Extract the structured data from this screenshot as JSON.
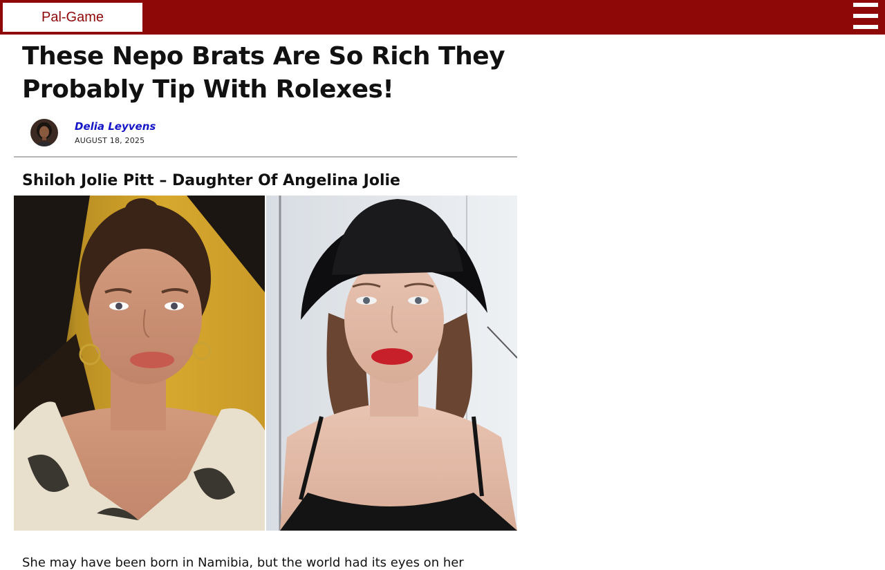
{
  "header": {
    "logo_text": "Pal-Game",
    "menu_icon": "hamburger-menu-icon",
    "background_color": "#8f0808"
  },
  "article": {
    "title": "These Nepo Brats Are So Rich They Probably Tip With Rolexes!",
    "author": "Delia Leyvens",
    "date": "AUGUST 18, 2025",
    "section_heading": "Shiloh Jolie Pitt – Daughter Of Angelina Jolie",
    "first_paragraph": "She may have been born in Namibia, but the world had its eyes on her"
  },
  "colors": {
    "accent": "#8f0808",
    "author_link": "#1515c8"
  }
}
